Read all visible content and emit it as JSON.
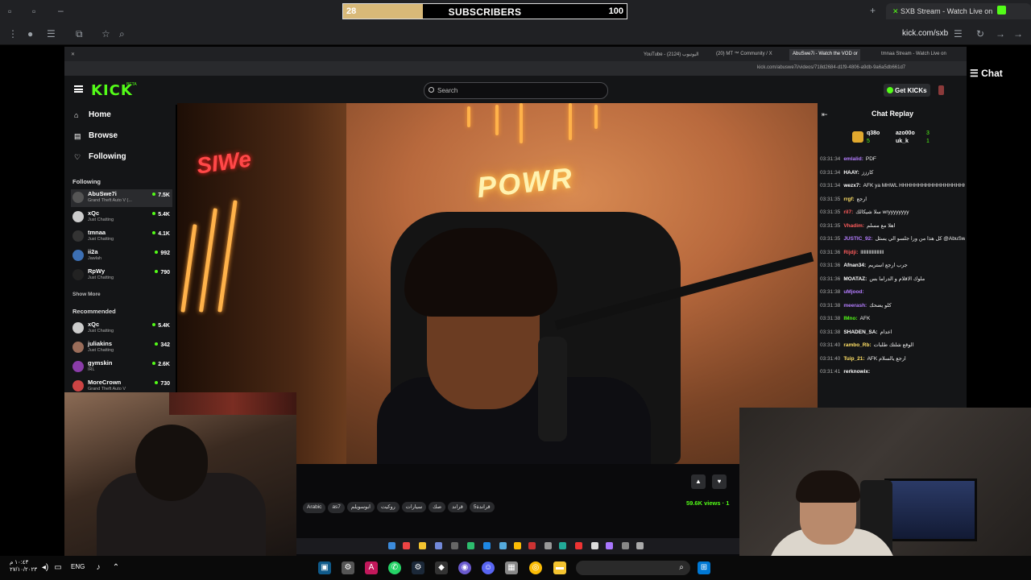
{
  "overlay": {
    "subscribers_label": "SUBSCRIBERS",
    "current": "28",
    "goal": "100",
    "progress": 0.28
  },
  "outer_browser": {
    "tab_title": "SXB Stream - Watch Live on",
    "url": "kick.com/sxb",
    "side_tab_label": "Chat"
  },
  "inner_browser": {
    "tabs": [
      "YouTube - اليوتيوب (2124)",
      "(20) MT ™ Community / X",
      "AbuSwe7i - Watch the VOD or",
      "tmnaa Stream - Watch Live on"
    ],
    "url": "kick.com/abuswe7i/videos/718d2684-d1f9-4806-a9db-9a6a5db661d7"
  },
  "kick": {
    "logo": "KICK",
    "logo_badge": "BETA",
    "search_placeholder": "Search",
    "get_kicks": "Get KICKs",
    "nav": [
      {
        "label": "Home",
        "icon": "home-icon"
      },
      {
        "label": "Browse",
        "icon": "browse-icon"
      },
      {
        "label": "Following",
        "icon": "heart-icon"
      }
    ],
    "following_title": "Following",
    "following": [
      {
        "name": "AbuSwe7i",
        "game": "Grand Theft Auto V (...",
        "viewers": "7.5K"
      },
      {
        "name": "xQc",
        "game": "Just Chatting",
        "viewers": "5.4K"
      },
      {
        "name": "tmnaa",
        "game": "Just Chatting",
        "viewers": "4.1K"
      },
      {
        "name": "ii2a",
        "game": "Jawlah",
        "viewers": "992"
      },
      {
        "name": "RpWy",
        "game": "Just Chatting",
        "viewers": "790"
      }
    ],
    "show_more": "Show More",
    "recommended_title": "Recommended",
    "recommended": [
      {
        "name": "xQc",
        "game": "Just Chatting",
        "viewers": "5.4K"
      },
      {
        "name": "juliakins",
        "game": "Just Chatting",
        "viewers": "342"
      },
      {
        "name": "gymskin",
        "game": "IRL",
        "viewers": "2.6K"
      },
      {
        "name": "MoreCrown",
        "game": "Grand Theft Auto V",
        "viewers": "730"
      }
    ],
    "video_sign_main": "POWR",
    "video_sign_left": "SIWe",
    "tags": [
      "Arabic",
      "as7",
      "ابوسويلم",
      "روكيت",
      "سيارات",
      "صك",
      "قراند",
      "قراندة5"
    ],
    "views": "59.6K views · 1",
    "chat": {
      "title": "Chat Replay",
      "leaders": [
        {
          "name": "q38o",
          "value": "5"
        },
        {
          "name": "azo00o",
          "value": "3"
        },
        {
          "name": "uk_k",
          "value": "1"
        }
      ],
      "messages": [
        {
          "time": "03:31:34",
          "user": "emlalid",
          "text": "PDF",
          "color": "#b47dff"
        },
        {
          "time": "03:31:34",
          "user": "HAAY",
          "text": "كارزز",
          "color": "#ffffff"
        },
        {
          "time": "03:31:34",
          "user": "wezx7",
          "text": "AFK ya MHWL HHHHHHHHHHHHHHHHHHH",
          "color": "#ffffff"
        },
        {
          "time": "03:31:35",
          "user": "rrgf",
          "text": "ارجع",
          "color": "#ffe066"
        },
        {
          "time": "03:31:35",
          "user": "ril7",
          "text": "سلا شيكالك wryyyyyyyy",
          "color": "#ff5c5c"
        },
        {
          "time": "03:31:35",
          "user": "Vhadim",
          "text": "اهلا مع مسلم",
          "color": "#ff5c5c"
        },
        {
          "time": "03:31:35",
          "user": "JUSTIC_92",
          "text": "كل هذا من ورا جلسو الي يسئل @AbuSwe7i",
          "color": "#b47dff"
        },
        {
          "time": "03:31:36",
          "user": "Rijdji",
          "text": "llllllllllllllllllll",
          "color": "#ff5c5c"
        },
        {
          "time": "03:31:36",
          "user": "Afnan34",
          "text": "جرب ارجع استريم",
          "color": "#ffffff"
        },
        {
          "time": "03:31:36",
          "user": "MOATAZ",
          "text": "ملوك الاقلام و الدراما بس",
          "color": "#ffffff"
        },
        {
          "time": "03:31:38",
          "user": "uMjood",
          "text": "",
          "color": "#b47dff"
        },
        {
          "time": "03:31:38",
          "user": "meerash",
          "text": "كلو يضحك",
          "color": "#b47dff"
        },
        {
          "time": "03:31:38",
          "user": "IMno",
          "text": "AFK",
          "color": "#53fc18"
        },
        {
          "time": "03:31:38",
          "user": "SHADEN_SA",
          "text": "اعدام",
          "color": "#ffffff"
        },
        {
          "time": "03:31:40",
          "user": "rambo_Rb",
          "text": "الوقع شلتك طلبات",
          "color": "#ffe066"
        },
        {
          "time": "03:31:40",
          "user": "Tuip_21",
          "text": "AFK ارجع يالسلام",
          "color": "#ffe066"
        },
        {
          "time": "03:31:41",
          "user": "rerknowix",
          "text": "",
          "color": "#ffffff"
        }
      ]
    }
  },
  "taskbar": {
    "lang": "ENG",
    "time": "١٠:٤٣ م",
    "date": "٢٧/١٠/٢٠٢٣"
  }
}
